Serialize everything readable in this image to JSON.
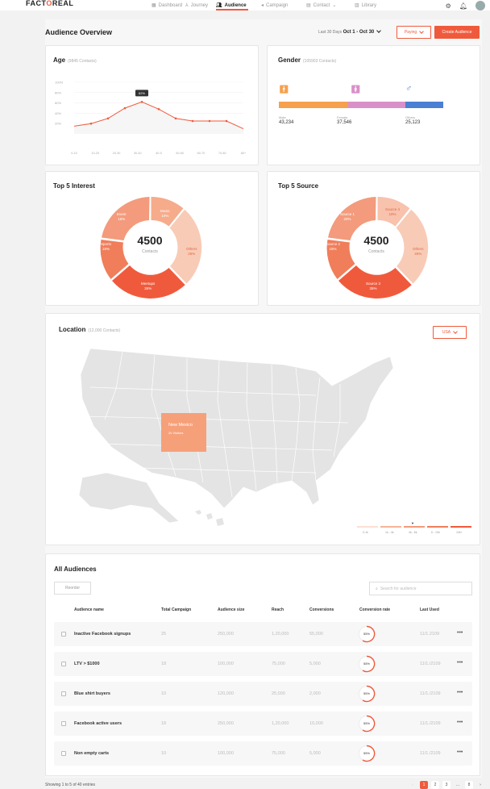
{
  "brand": {
    "name_pre": "FACT",
    "name_o": "O",
    "name_post": "REAL",
    "accent": "#f05a3c"
  },
  "nav": {
    "items": [
      {
        "label": "Dashboard",
        "icon": "grid-icon"
      },
      {
        "label": "Journey",
        "icon": "journey-icon"
      },
      {
        "label": "Audience",
        "icon": "users-icon",
        "active": true
      },
      {
        "label": "Campaign",
        "icon": "megaphone-icon"
      },
      {
        "label": "Contact",
        "icon": "contact-icon"
      },
      {
        "label": "Library",
        "icon": "library-icon"
      }
    ]
  },
  "overview": {
    "title": "Audience Overview",
    "range_label": "Last 30 Days",
    "range_value": "Oct 1 - Oct 30",
    "paying_label": "Paying",
    "create_label": "Create Audience"
  },
  "age": {
    "title": "Age",
    "count": "(9845 Contacts)",
    "tooltip": "62%",
    "chart_data": {
      "type": "line",
      "categories": [
        "0-10",
        "10-20",
        "20-30",
        "30-40",
        "40-5",
        "50-60",
        "60-70",
        "70-80",
        "80+"
      ],
      "values": [
        15,
        20,
        30,
        50,
        62,
        48,
        30,
        25,
        25,
        25,
        10
      ],
      "ylabels": [
        "100%",
        "80%",
        "60%",
        "40%",
        "20%"
      ],
      "ylim": [
        0,
        100
      ]
    }
  },
  "gender": {
    "title": "Gender",
    "count": "(105903 Contacts)",
    "items": [
      {
        "label": "Male",
        "value": "43,234",
        "color": "#f6a04d"
      },
      {
        "label": "Female",
        "value": "37,546",
        "color": "#d990c9"
      },
      {
        "label": "Others",
        "value": "25,123",
        "color": "#4a7fd4"
      }
    ]
  },
  "interest": {
    "title": "Top 5 Interest",
    "center_value": "4500",
    "center_label": "Contacts",
    "segments": [
      {
        "name": "Music",
        "pct": "10%"
      },
      {
        "name": "Others",
        "pct": "25%"
      },
      {
        "name": "Meetups",
        "pct": "35%"
      },
      {
        "name": "Sports",
        "pct": "15%"
      },
      {
        "name": "Event",
        "pct": "15%"
      }
    ]
  },
  "source": {
    "title": "Top 5 Source",
    "center_value": "4500",
    "center_label": "Contacts",
    "segments": [
      {
        "name": "Source 4",
        "pct": "10%"
      },
      {
        "name": "Others",
        "pct": "25%"
      },
      {
        "name": "Source 3",
        "pct": "35%"
      },
      {
        "name": "Source 2",
        "pct": "15%"
      },
      {
        "name": "Source 1",
        "pct": "20%"
      }
    ]
  },
  "location": {
    "title": "Location",
    "count": "(12,000 Contacts)",
    "country": "USA",
    "highlight_state": "New Mexico",
    "highlight_sub": "2k Visitors",
    "legend": [
      "0-1k",
      "1k - 4k",
      "4k - 6k",
      "6 - 10k",
      "10k+"
    ]
  },
  "audiences": {
    "title": "All Audiences",
    "reorder_label": "Reorder",
    "search_placeholder": "Search for audience",
    "columns": [
      "Audience name",
      "Total Campaign",
      "Audience size",
      "Reach",
      "Conversions",
      "Conversion rate",
      "Last Used"
    ],
    "rows": [
      {
        "name": "Inactive Facebook signups",
        "campaign": "25",
        "size": "250,000",
        "reach": "1,20,000",
        "conv": "55,000",
        "rate": "55%",
        "last": "11/1.2109"
      },
      {
        "name": "LTV > $1000",
        "campaign": "18",
        "size": "100,000",
        "reach": "75,000",
        "conv": "5,000",
        "rate": "55%",
        "last": "11/1./2109"
      },
      {
        "name": "Blue shirt buyers",
        "campaign": "10",
        "size": "120,000",
        "reach": "25,000",
        "conv": "2,000",
        "rate": "55%",
        "last": "11/1./2109"
      },
      {
        "name": "Facebook active users",
        "campaign": "18",
        "size": "250,000",
        "reach": "1,20,000",
        "conv": "10,000",
        "rate": "55%",
        "last": "11/1./2109"
      },
      {
        "name": "Non empty carts",
        "campaign": "10",
        "size": "100,000",
        "reach": "75,000",
        "conv": "5,000",
        "rate": "55%",
        "last": "11/1./2109"
      }
    ],
    "footer": "Showing 1 to 5 of 40 entries",
    "pages": [
      "1",
      "2",
      "3",
      "8"
    ]
  }
}
